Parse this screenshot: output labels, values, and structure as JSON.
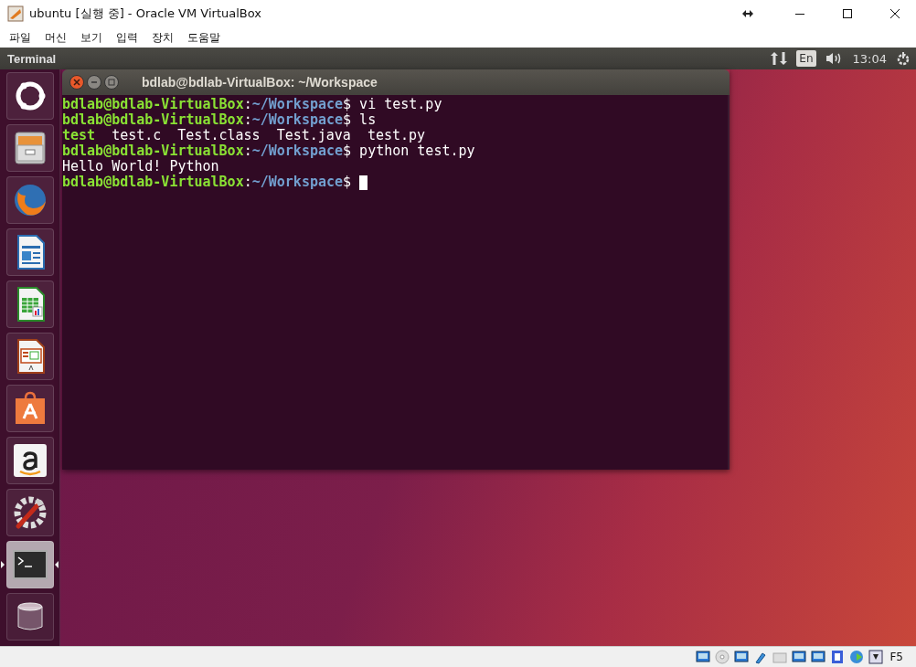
{
  "window": {
    "title": "ubuntu [실행 중] - Oracle VM VirtualBox"
  },
  "menu": [
    "파일",
    "머신",
    "보기",
    "입력",
    "장치",
    "도움말"
  ],
  "top_panel": {
    "app_title": "Terminal",
    "keyboard": "En",
    "clock": "13:04"
  },
  "launcher": [
    {
      "kind": "dash",
      "selected": false
    },
    {
      "kind": "files",
      "selected": false
    },
    {
      "kind": "browser",
      "selected": false
    },
    {
      "kind": "writer",
      "selected": false
    },
    {
      "kind": "calc",
      "selected": false
    },
    {
      "kind": "impress",
      "selected": false
    },
    {
      "kind": "store",
      "selected": false
    },
    {
      "kind": "amazon",
      "selected": false
    },
    {
      "kind": "settings",
      "selected": false
    },
    {
      "kind": "terminal",
      "selected": true
    },
    {
      "kind": "trash",
      "selected": false
    }
  ],
  "terminal": {
    "title": "bdlab@bdlab-VirtualBox: ~/Workspace",
    "lines": [
      {
        "kind": "prompt",
        "user_host": "bdlab@bdlab-VirtualBox",
        "separator": ":",
        "path": "~/Workspace",
        "sigil": "$",
        "command": "vi test.py"
      },
      {
        "kind": "prompt",
        "user_host": "bdlab@bdlab-VirtualBox",
        "separator": ":",
        "path": "~/Workspace",
        "sigil": "$",
        "command": "ls"
      },
      {
        "kind": "listing",
        "entries": [
          {
            "name": "test",
            "executable": true
          },
          {
            "name": "test.c",
            "executable": false
          },
          {
            "name": "Test.class",
            "executable": false
          },
          {
            "name": "Test.java",
            "executable": false
          },
          {
            "name": "test.py",
            "executable": false
          }
        ]
      },
      {
        "kind": "prompt",
        "user_host": "bdlab@bdlab-VirtualBox",
        "separator": ":",
        "path": "~/Workspace",
        "sigil": "$",
        "command": "python test.py"
      },
      {
        "kind": "output",
        "text": "Hello World! Python"
      },
      {
        "kind": "prompt",
        "user_host": "bdlab@bdlab-VirtualBox",
        "separator": ":",
        "path": "~/Workspace",
        "sigil": "$",
        "cursor": true
      }
    ]
  },
  "status_bar": {
    "host_key": "F5"
  }
}
